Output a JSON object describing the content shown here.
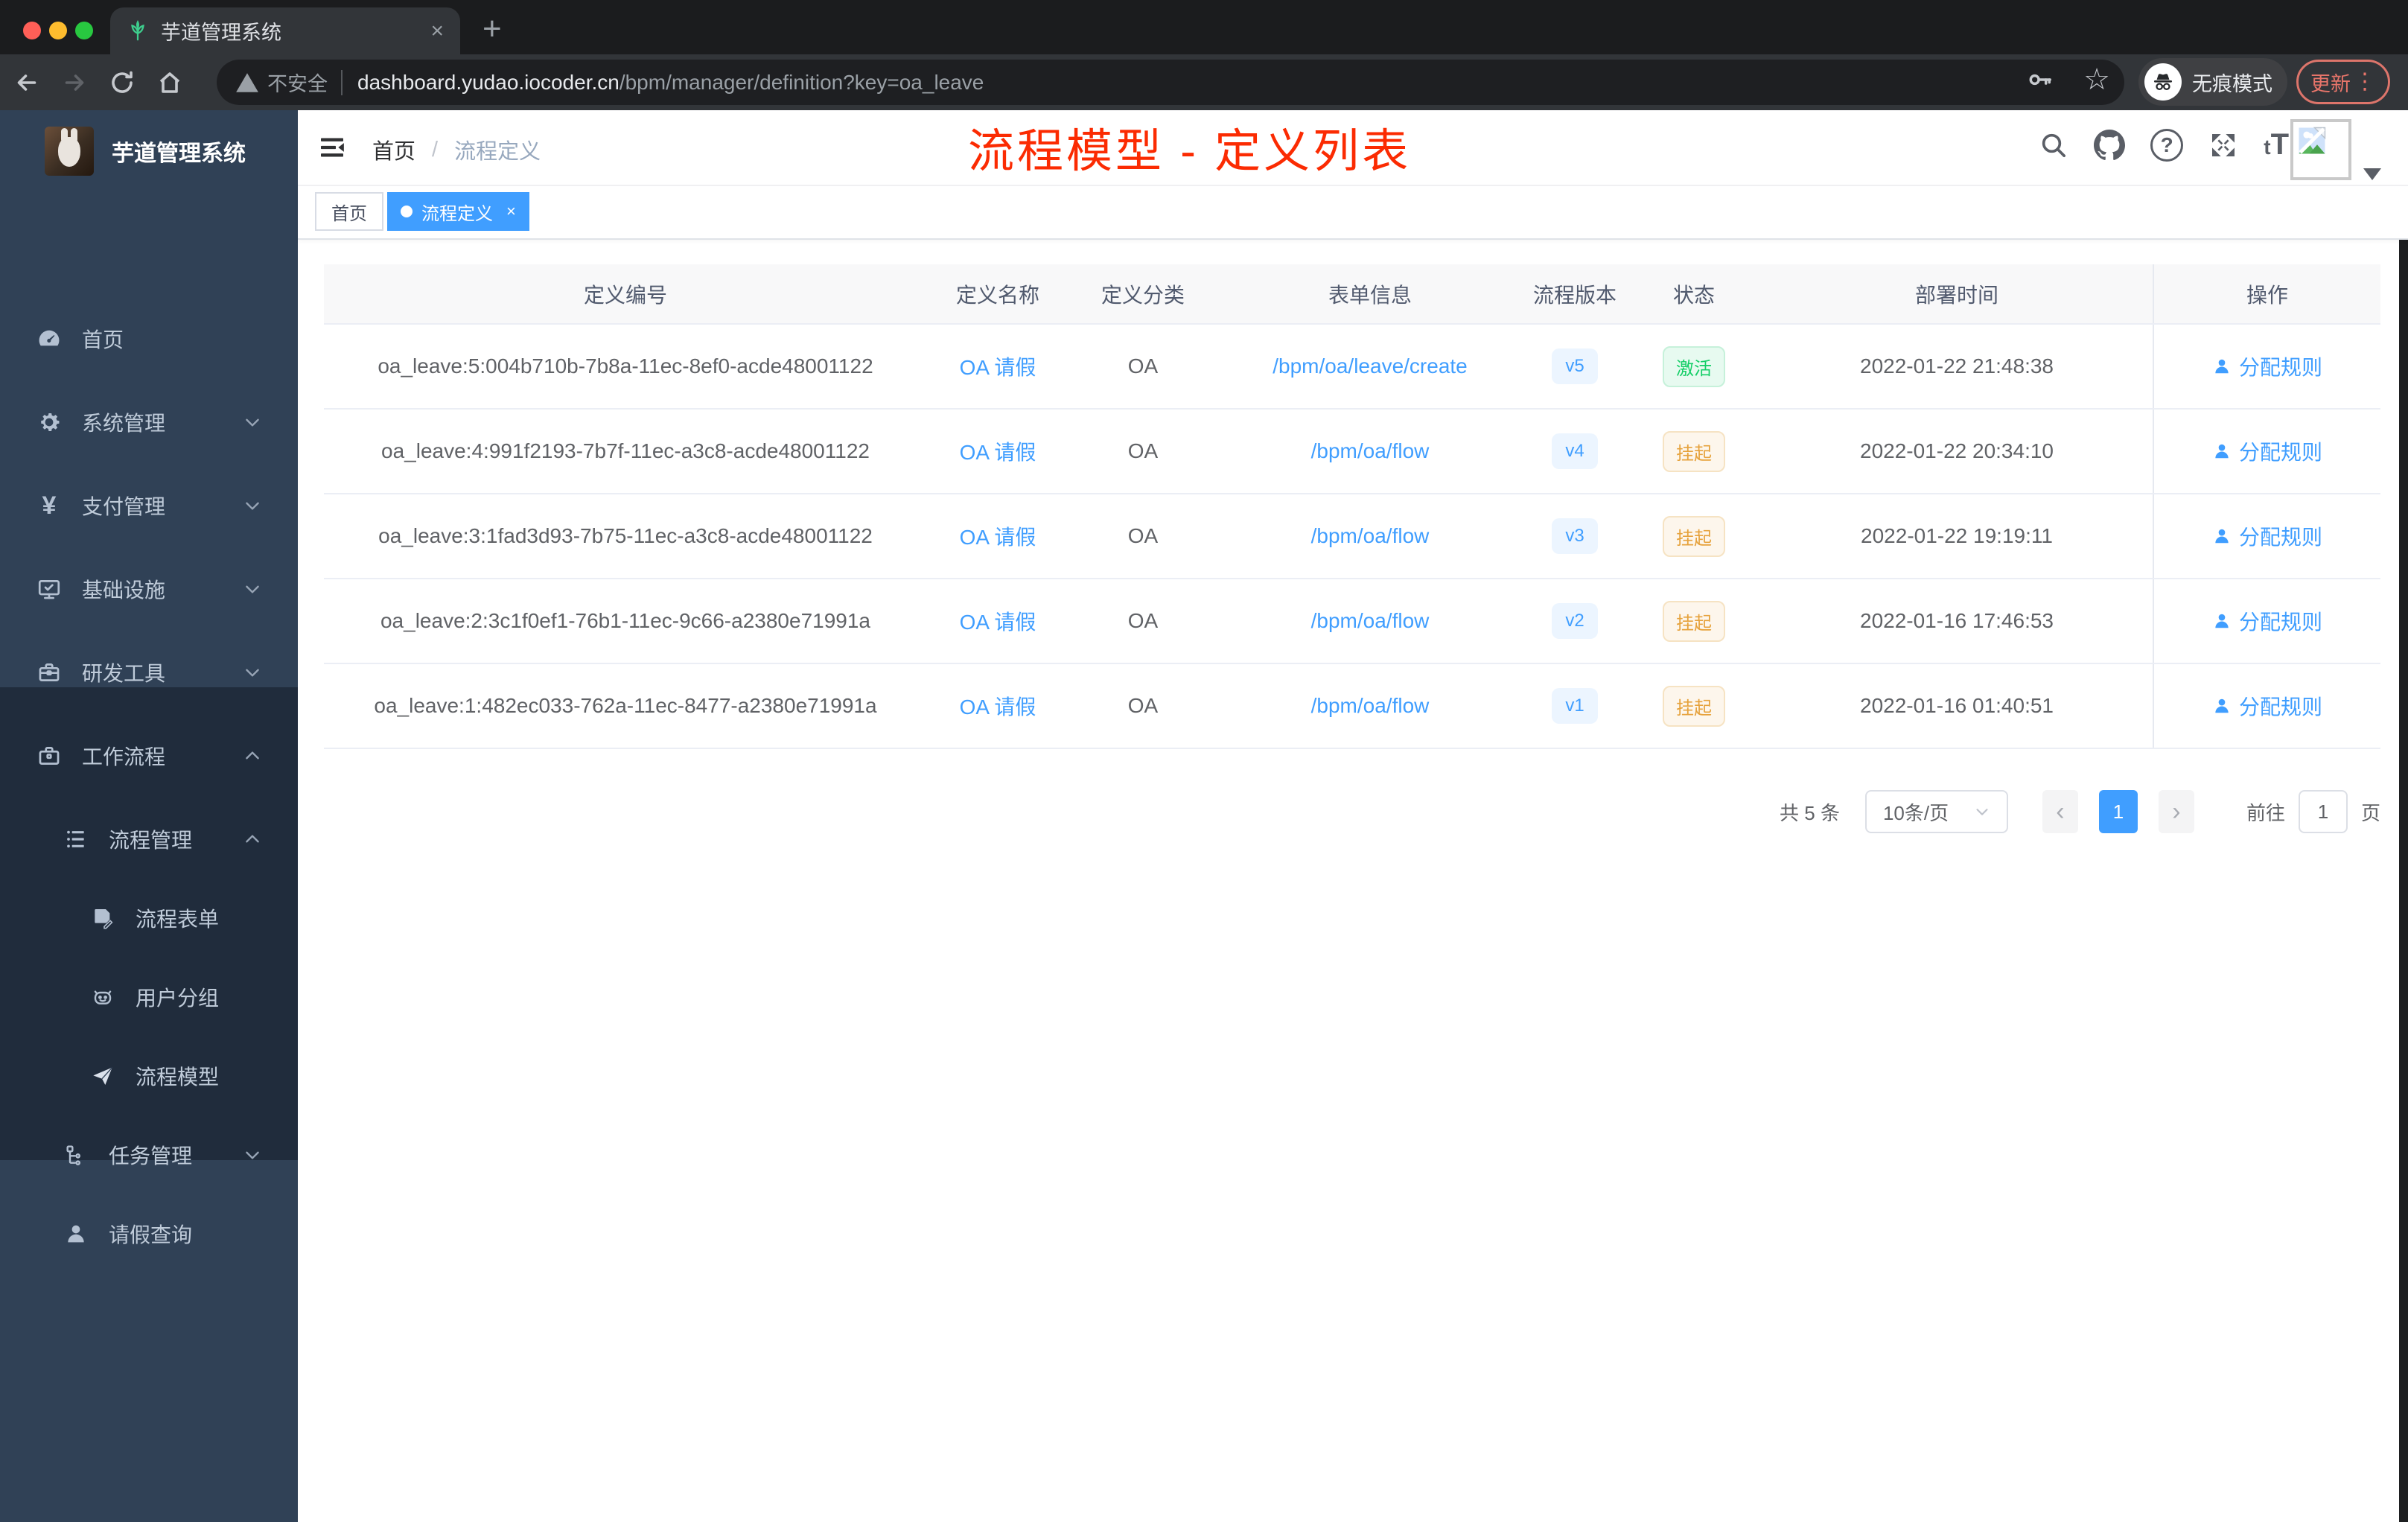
{
  "glyphs": {
    "close": "×",
    "add": "+",
    "dots": "⋮",
    "star": "☆",
    "question": "?",
    "slash": "/",
    "yen": "¥",
    "small_t": "t",
    "big_t": "T",
    "prev": "‹",
    "next": "›"
  },
  "browser": {
    "tab_title": "芋道管理系统",
    "security_label": "不安全",
    "url_domain": "dashboard.yudao.iocoder.cn",
    "url_path": "/bpm/manager/definition?key=oa_leave",
    "incognito_label": "无痕模式",
    "update_label": "更新"
  },
  "sidebar": {
    "logo_title": "芋道管理系统",
    "items": [
      {
        "label": "首页"
      },
      {
        "label": "系统管理"
      },
      {
        "label": "支付管理"
      },
      {
        "label": "基础设施"
      },
      {
        "label": "研发工具"
      },
      {
        "label": "工作流程"
      }
    ],
    "subitems": [
      {
        "label": "流程管理"
      },
      {
        "label": "流程表单"
      },
      {
        "label": "用户分组"
      },
      {
        "label": "流程模型"
      },
      {
        "label": "任务管理"
      },
      {
        "label": "请假查询"
      }
    ]
  },
  "navbar": {
    "breadcrumb_home": "首页",
    "breadcrumb_current": "流程定义"
  },
  "tags": {
    "home": "首页",
    "active": "流程定义"
  },
  "annotation": {
    "title": "流程模型 - 定义列表"
  },
  "table": {
    "headers": [
      "定义编号",
      "定义名称",
      "定义分类",
      "表单信息",
      "流程版本",
      "状态",
      "部署时间",
      "操作"
    ],
    "rows": [
      {
        "id": "oa_leave:5:004b710b-7b8a-11ec-8ef0-acde48001122",
        "name": "OA 请假",
        "category": "OA",
        "form": "/bpm/oa/leave/create",
        "version": "v5",
        "status": "激活",
        "deploy_time": "2022-01-22 21:48:38",
        "action": "分配规则"
      },
      {
        "id": "oa_leave:4:991f2193-7b7f-11ec-a3c8-acde48001122",
        "name": "OA 请假",
        "category": "OA",
        "form": "/bpm/oa/flow",
        "version": "v4",
        "status": "挂起",
        "deploy_time": "2022-01-22 20:34:10",
        "action": "分配规则"
      },
      {
        "id": "oa_leave:3:1fad3d93-7b75-11ec-a3c8-acde48001122",
        "name": "OA 请假",
        "category": "OA",
        "form": "/bpm/oa/flow",
        "version": "v3",
        "status": "挂起",
        "deploy_time": "2022-01-22 19:19:11",
        "action": "分配规则"
      },
      {
        "id": "oa_leave:2:3c1f0ef1-76b1-11ec-9c66-a2380e71991a",
        "name": "OA 请假",
        "category": "OA",
        "form": "/bpm/oa/flow",
        "version": "v2",
        "status": "挂起",
        "deploy_time": "2022-01-16 17:46:53",
        "action": "分配规则"
      },
      {
        "id": "oa_leave:1:482ec033-762a-11ec-8477-a2380e71991a",
        "name": "OA 请假",
        "category": "OA",
        "form": "/bpm/oa/flow",
        "version": "v1",
        "status": "挂起",
        "deploy_time": "2022-01-16 01:40:51",
        "action": "分配规则"
      }
    ]
  },
  "pagination": {
    "total": "共 5 条",
    "page_size": "10条/页",
    "current_page": "1",
    "goto_prefix": "前往",
    "goto_value": "1",
    "goto_suffix": "页"
  },
  "colors": {
    "accent": "#409eff",
    "sidebar_bg": "#304156",
    "submenu_bg": "#202c3c",
    "status_active": "#13ce66",
    "status_suspend": "#e6a23c",
    "annotation_red": "#fb2b02"
  }
}
